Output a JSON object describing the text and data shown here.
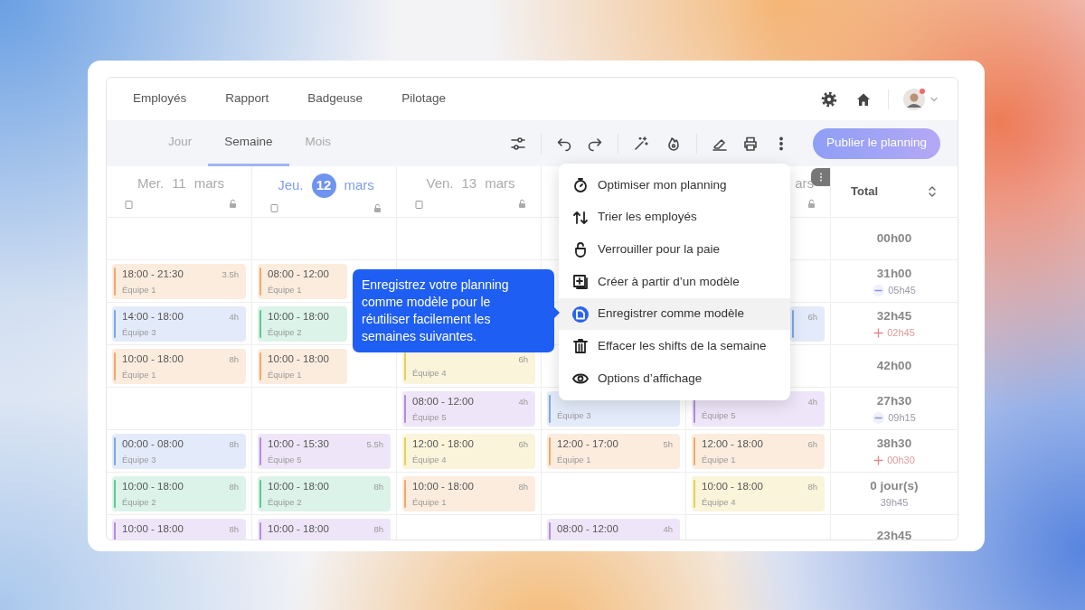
{
  "nav": {
    "links": [
      "Employés",
      "Rapport",
      "Badgeuse",
      "Pilotage"
    ],
    "avatar_badge": true
  },
  "views": [
    {
      "label": "Jour",
      "selected": false
    },
    {
      "label": "Semaine",
      "selected": true
    },
    {
      "label": "Mois",
      "selected": false
    }
  ],
  "publish_button": "Publier le planning",
  "days": [
    {
      "kind": "full",
      "weekday": "Mer.",
      "day": "11",
      "month": "mars",
      "today": false
    },
    {
      "kind": "full",
      "weekday": "Jeu.",
      "day": "12",
      "month": "mars",
      "today": true
    },
    {
      "kind": "full",
      "weekday": "Ven.",
      "day": "13",
      "month": "mars",
      "today": false
    },
    {
      "kind": "covered"
    },
    {
      "kind": "partial",
      "text": "ars"
    }
  ],
  "total_header": "Total",
  "rows": [
    {
      "cells": [
        null,
        null,
        null,
        null,
        null
      ],
      "total": "00h00"
    },
    {
      "cells": [
        {
          "time": "18:00 - 21:30",
          "hours": "3.5h",
          "team": "Équipe 1",
          "color": "#f0a868"
        },
        {
          "time": "08:00 - 12:00",
          "team": "Équipe 1",
          "color": "#f0a868"
        },
        null,
        null,
        null
      ],
      "total": "31h00",
      "diff": {
        "kind": "minus",
        "text": "05h45"
      }
    },
    {
      "cells": [
        {
          "time": "14:00 - 18:00",
          "hours": "4h",
          "team": "Équipe 3",
          "color": "#7ea6e8"
        },
        {
          "time": "10:00 - 18:00",
          "team": "Équipe 2",
          "color": "#5cc995"
        },
        null,
        null,
        {
          "hours": "6h",
          "color": "#7ea6e8"
        }
      ],
      "total": "32h45",
      "diff": {
        "kind": "plus",
        "text": "02h45"
      }
    },
    {
      "cells": [
        {
          "time": "10:00 - 18:00",
          "hours": "8h",
          "team": "Équipe 1",
          "color": "#f0a868"
        },
        {
          "time": "10:00 - 18:00",
          "team": "Équipe 1",
          "color": "#f0a868"
        },
        {
          "hours": "6h",
          "team": "Équipe 4",
          "color": "#e6cf55"
        },
        null,
        null
      ],
      "total": "42h00"
    },
    {
      "cells": [
        null,
        null,
        {
          "time": "08:00 - 12:00",
          "hours": "4h",
          "team": "Équipe 5",
          "color": "#b28be0"
        },
        {
          "team": "Équipe 3",
          "color": "#7ea6e8"
        },
        {
          "hours": "4h",
          "team": "Équipe 5",
          "color": "#b28be0"
        }
      ],
      "total": "27h30",
      "diff": {
        "kind": "minus",
        "text": "09h15"
      }
    },
    {
      "cells": [
        {
          "time": "00:00 - 08:00",
          "hours": "8h",
          "team": "Équipe 3",
          "color": "#7ea6e8"
        },
        {
          "time": "10:00 - 15:30",
          "hours": "5.5h",
          "team": "Équipe 5",
          "color": "#b28be0"
        },
        {
          "time": "12:00 - 18:00",
          "hours": "6h",
          "team": "Équipe 4",
          "color": "#e6cf55"
        },
        {
          "time": "12:00 - 17:00",
          "hours": "5h",
          "team": "Équipe 1",
          "color": "#f0a868"
        },
        {
          "time": "12:00 - 18:00",
          "hours": "6h",
          "team": "Équipe 1",
          "color": "#f0a868"
        }
      ],
      "total": "38h30",
      "diff": {
        "kind": "plus",
        "text": "00h30"
      }
    },
    {
      "cells": [
        {
          "time": "10:00 - 18:00",
          "hours": "8h",
          "team": "Équipe 2",
          "color": "#5cc995"
        },
        {
          "time": "10:00 - 18:00",
          "hours": "8h",
          "team": "Équipe 2",
          "color": "#5cc995"
        },
        {
          "time": "10:00 - 18:00",
          "hours": "8h",
          "team": "Équipe 1",
          "color": "#f0a868"
        },
        null,
        {
          "time": "10:00 - 18:00",
          "hours": "8h",
          "team": "Équipe 4",
          "color": "#e6cf55"
        }
      ],
      "total": "0 jour(s)",
      "diff": {
        "kind": "none",
        "text": "39h45"
      }
    },
    {
      "cells": [
        {
          "time": "10:00 - 18:00",
          "hours": "8h",
          "color": "#b28be0"
        },
        {
          "time": "10:00 - 18:00",
          "hours": "8h",
          "color": "#b28be0"
        },
        null,
        {
          "time": "08:00 - 12:00",
          "hours": "4h",
          "color": "#b28be0"
        },
        null
      ],
      "total": "23h45"
    }
  ],
  "menu": [
    {
      "label": "Optimiser mon planning",
      "selected": false
    },
    {
      "label": "Trier les employés",
      "selected": false
    },
    {
      "label": "Verrouiller pour la paie",
      "selected": false
    },
    {
      "label": "Créer à partir d’un modèle",
      "selected": false
    },
    {
      "label": "Enregistrer comme modèle",
      "selected": true
    },
    {
      "label": "Effacer les shifts de la semaine",
      "selected": false
    },
    {
      "label": "Options d’affichage",
      "selected": false
    }
  ],
  "tooltip": "Enregistrez votre planning comme modèle pour le réutiliser facilement les semaines suivantes."
}
